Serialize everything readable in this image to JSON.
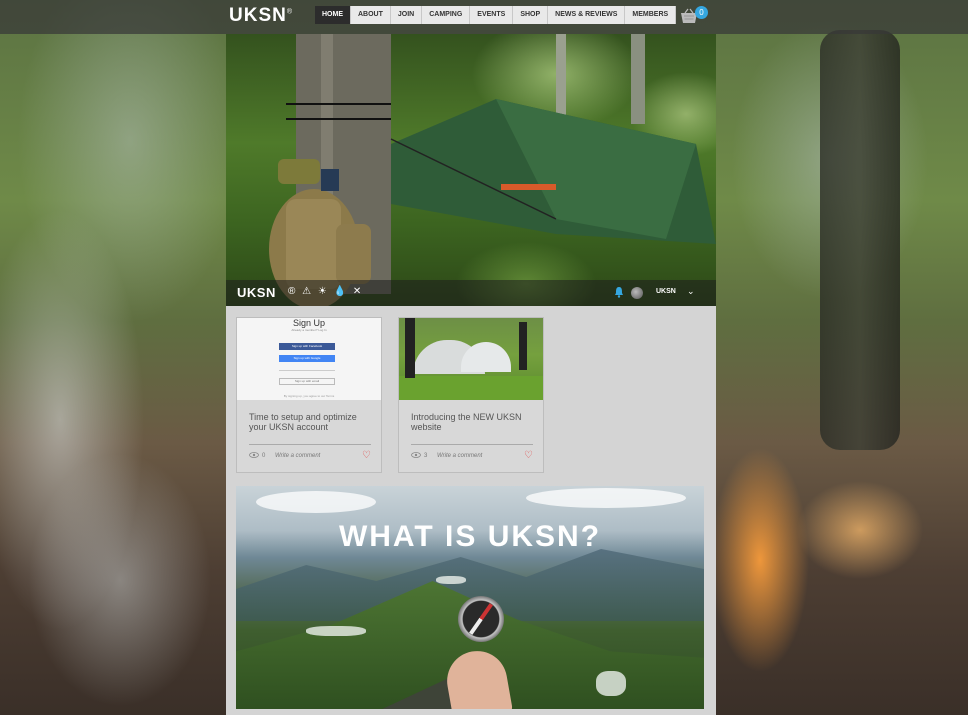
{
  "header": {
    "logo": "UKSN",
    "logo_mark": "®",
    "nav": [
      {
        "label": "HOME",
        "active": true
      },
      {
        "label": "ABOUT",
        "active": false
      },
      {
        "label": "JOIN",
        "active": false
      },
      {
        "label": "CAMPING",
        "active": false
      },
      {
        "label": "EVENTS",
        "active": false
      },
      {
        "label": "SHOP",
        "active": false
      },
      {
        "label": "NEWS & REVIEWS",
        "active": false
      },
      {
        "label": "MEMBERS",
        "active": false
      }
    ],
    "cart_count": "0",
    "cart_icon": "basket-icon"
  },
  "hero": {
    "brand": "UKSN",
    "brand_marks": "® ⚠ ☀ 💧 ✕",
    "username": "UKSN",
    "notification_icon": "bell-icon",
    "accent_color": "#35a7e0"
  },
  "posts": [
    {
      "image_title": "Sign Up",
      "image_sub": "Already a member? Log In",
      "fb_label": "Sign up with Facebook",
      "google_label": "Sign up with Google",
      "or_label": "or",
      "email_label": "Sign up with email",
      "foot": "By signing up, you agree to our Terms",
      "title": "Time to setup and optimize your UKSN account",
      "views": "0",
      "comment_label": "Write a comment"
    },
    {
      "title": "Introducing the NEW UKSN website",
      "views": "3",
      "comment_label": "Write a comment"
    }
  ],
  "promo": {
    "title": "WHAT IS UKSN?"
  }
}
